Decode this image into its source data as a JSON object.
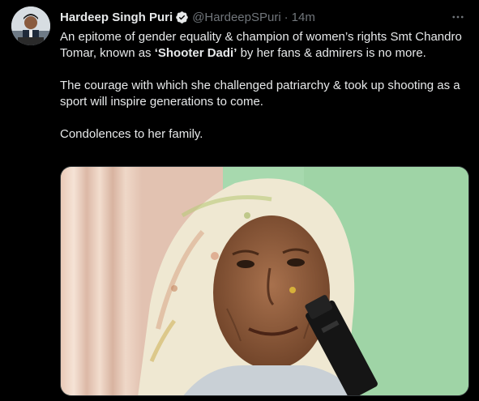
{
  "tweet": {
    "author_name": "Hardeep Singh Puri",
    "handle": "@HardeepSPuri",
    "separator": "·",
    "time": "14m",
    "more_icon": "more-horizontal-icon",
    "verified_icon": "verified-badge-icon",
    "text": {
      "para1_before": "An epitome of gender equality & champion of women’s rights Smt Chandro Tomar, known as ",
      "para1_bold": "‘Shooter Dadi’",
      "para1_after": " by her fans & admirers is no more.",
      "para2": "The courage with which she challenged patriarchy & took up shooting as a sport will inspire generations to come.",
      "para3": "Condolences to her family."
    },
    "media": {
      "description_icon": "photo",
      "colors": {
        "wall_green": "#a9dbb0",
        "curtain": "#e8d2c2",
        "skin": "#8a5a3c",
        "scarf": "#efe7d0",
        "pistol": "#161616"
      }
    }
  },
  "colors": {
    "background": "#000000",
    "text_primary": "#e7e9ea",
    "text_secondary": "#71767b",
    "verified_blue": "#ffffff"
  }
}
